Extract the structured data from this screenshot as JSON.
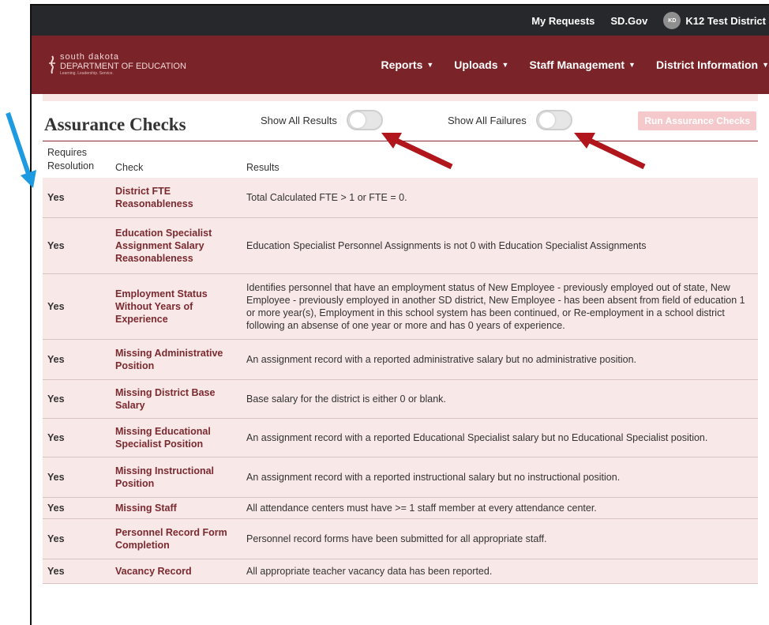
{
  "topbar": {
    "my_requests": "My Requests",
    "sd_gov": "SD.Gov",
    "user_initials": "KD",
    "user_name": "K12 Test District"
  },
  "logo": {
    "line1": "south dakota",
    "line2": "DEPARTMENT OF EDUCATION",
    "tagline": "Learning. Leadership. Service."
  },
  "nav": {
    "items": [
      "Reports",
      "Uploads",
      "Staff Management",
      "District Information"
    ]
  },
  "page": {
    "title": "Assurance Checks",
    "show_all_results": "Show All Results",
    "show_all_failures": "Show All Failures",
    "run_button": "Run Assurance Checks"
  },
  "toggles": {
    "show_all_results_on": false,
    "show_all_failures_on": false
  },
  "table": {
    "headers": {
      "requires": "Requires Resolution",
      "check": "Check",
      "results": "Results"
    },
    "rows": [
      {
        "requires": "Yes",
        "check": "District FTE Reasonableness",
        "result": "Total Calculated FTE > 1 or FTE = 0."
      },
      {
        "requires": "Yes",
        "check": "Education Specialist Assignment Salary Reasonableness",
        "result": "Education Specialist Personnel Assignments is not 0 with Education Specialist Assignments"
      },
      {
        "requires": "Yes",
        "check": "Employment Status Without Years of Experience",
        "result": "Identifies personnel that have an employment status of New Employee - previously employed out of state, New Employee - previously employed in another SD district, New Employee - has been absent from field of education 1 or more year(s), Employment in this school system has been continued, or Re-employment in a school district following an absense of one year or more and has 0 years of experience."
      },
      {
        "requires": "Yes",
        "check": "Missing Administrative Position",
        "result": "An assignment record with a reported administrative salary but no administrative position."
      },
      {
        "requires": "Yes",
        "check": "Missing District Base Salary",
        "result": "Base salary for the district is either 0 or blank."
      },
      {
        "requires": "Yes",
        "check": "Missing Educational Specialist Position",
        "result": "An assignment record with a reported Educational Specialist salary but no Educational Specialist position."
      },
      {
        "requires": "Yes",
        "check": "Missing Instructional Position",
        "result": "An assignment record with a reported instructional salary but no instructional position."
      },
      {
        "requires": "Yes",
        "check": "Missing Staff",
        "result": "All attendance centers must have >= 1 staff member at every attendance center."
      },
      {
        "requires": "Yes",
        "check": "Personnel Record Form Completion",
        "result": "Personnel record forms have been submitted for all appropriate staff."
      },
      {
        "requires": "Yes",
        "check": "Vacancy Record",
        "result": "All appropriate teacher vacancy data has been reported."
      }
    ]
  },
  "icons": {
    "caret": "caret-down-icon",
    "logo": "sd-doe-logo-icon"
  },
  "colors": {
    "topbar": "#26282b",
    "navbar": "#7a2329",
    "row_bg": "#f9e8e8",
    "check_text": "#7b2a30",
    "annotation_red": "#b0161c",
    "annotation_blue": "#1e9be0"
  }
}
